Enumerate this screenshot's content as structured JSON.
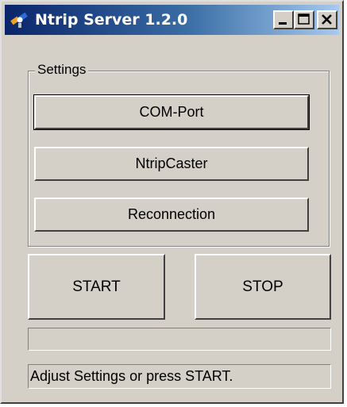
{
  "window": {
    "title": "Ntrip Server 1.2.0",
    "icon": "satellite-icon",
    "controls": [
      "minimize-icon",
      "maximize-icon",
      "close-icon"
    ]
  },
  "settings": {
    "group_label": "Settings",
    "com_port_label": "COM-Port",
    "caster_label": "NtripCaster",
    "reconnection_label": "Reconnection"
  },
  "actions": {
    "start_label": "START",
    "stop_label": "STOP"
  },
  "progress": {
    "value": 0
  },
  "status_text": "Adjust Settings or press START.",
  "colors": {
    "titlebar_start": "#0a246a",
    "titlebar_end": "#a6caf0",
    "face": "#d4d0c8"
  }
}
